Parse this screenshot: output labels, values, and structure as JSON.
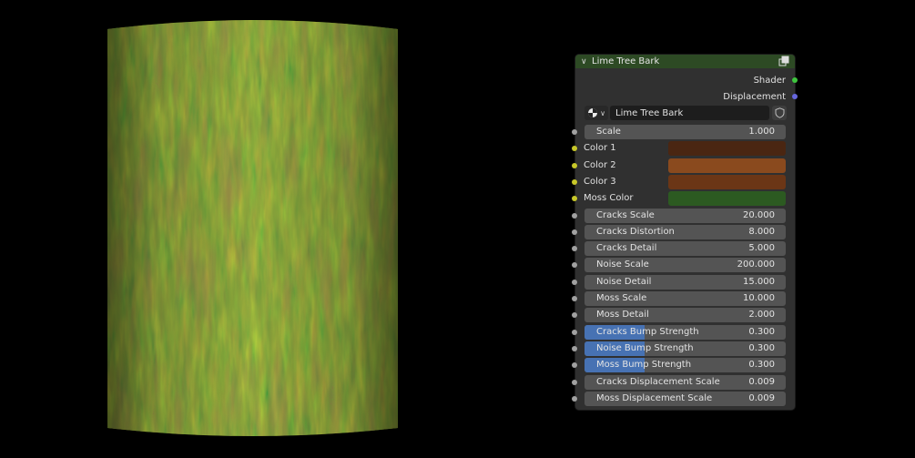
{
  "node": {
    "title": "Lime Tree Bark",
    "outputs": [
      {
        "label": "Shader",
        "socket_color": "#3ec43e"
      },
      {
        "label": "Displacement",
        "socket_color": "#6666dd"
      }
    ],
    "group_name": "Lime Tree Bark",
    "inputs": [
      {
        "type": "value",
        "label": "Scale",
        "value": "1.000",
        "fill": 0
      },
      {
        "type": "color",
        "label": "Color 1",
        "color": "#4a2612"
      },
      {
        "type": "color",
        "label": "Color 2",
        "color": "#8a4a1e"
      },
      {
        "type": "color",
        "label": "Color 3",
        "color": "#6b3616"
      },
      {
        "type": "color",
        "label": "Moss Color",
        "color": "#2c5a21"
      },
      {
        "type": "value",
        "label": "Cracks Scale",
        "value": "20.000",
        "fill": 0
      },
      {
        "type": "value",
        "label": "Cracks Distortion",
        "value": "8.000",
        "fill": 0
      },
      {
        "type": "value",
        "label": "Cracks Detail",
        "value": "5.000",
        "fill": 0
      },
      {
        "type": "value",
        "label": "Noise Scale",
        "value": "200.000",
        "fill": 0
      },
      {
        "type": "value",
        "label": "Noise Detail",
        "value": "15.000",
        "fill": 0
      },
      {
        "type": "value",
        "label": "Moss Scale",
        "value": "10.000",
        "fill": 0
      },
      {
        "type": "value",
        "label": "Moss Detail",
        "value": "2.000",
        "fill": 0
      },
      {
        "type": "value",
        "label": "Cracks Bump Strength",
        "value": "0.300",
        "fill": 0.3
      },
      {
        "type": "value",
        "label": "Noise Bump Strength",
        "value": "0.300",
        "fill": 0.3
      },
      {
        "type": "value",
        "label": "Moss Bump Strength",
        "value": "0.300",
        "fill": 0.3
      },
      {
        "type": "value",
        "label": "Cracks Displacement Scale",
        "value": "0.009",
        "fill": 0
      },
      {
        "type": "value",
        "label": "Moss Displacement Scale",
        "value": "0.009",
        "fill": 0
      }
    ]
  },
  "icons": {
    "collapse": "chevron-down-icon",
    "node_group": "node-group-icon",
    "material_browse": "material-sphere-icon",
    "fake_user": "shield-icon"
  },
  "colors": {
    "header": "#2d4a24",
    "panel": "#303030",
    "field": "#545454",
    "slider_fill": "#4772b3",
    "socket_value": "#a1a1a1",
    "socket_color": "#c7c729"
  }
}
